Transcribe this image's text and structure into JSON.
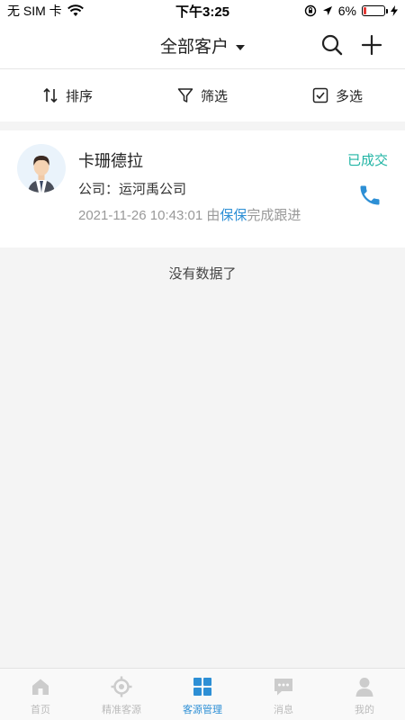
{
  "status_bar": {
    "carrier": "无 SIM 卡",
    "time": "下午3:25",
    "battery_text": "6%",
    "battery_level": 0.06,
    "battery_color": "#e53935"
  },
  "header": {
    "title": "全部客户",
    "icons": [
      "search-icon",
      "plus-icon",
      "chevron-down-icon"
    ]
  },
  "filters": {
    "sort_label": "排序",
    "filter_label": "筛选",
    "multi_label": "多选"
  },
  "customers": [
    {
      "name": "卡珊德拉",
      "company": "公司：运河禹公司",
      "follow_time": "2021-11-26 10:43:01",
      "follow_prefix": "由",
      "follow_user": "保保",
      "follow_suffix": "完成跟进",
      "status": "已成交",
      "status_color": "#20b4a4"
    }
  ],
  "list_end_text": "没有数据了",
  "tabs": [
    {
      "label": "首页",
      "icon": "home-icon",
      "active": false
    },
    {
      "label": "精准客源",
      "icon": "target-icon",
      "active": false
    },
    {
      "label": "客源管理",
      "icon": "grid-icon",
      "active": true
    },
    {
      "label": "消息",
      "icon": "message-icon",
      "active": false
    },
    {
      "label": "我的",
      "icon": "user-icon",
      "active": false
    }
  ],
  "colors": {
    "accent": "#2d8fd5",
    "inactive_tab": "#cccccc"
  }
}
